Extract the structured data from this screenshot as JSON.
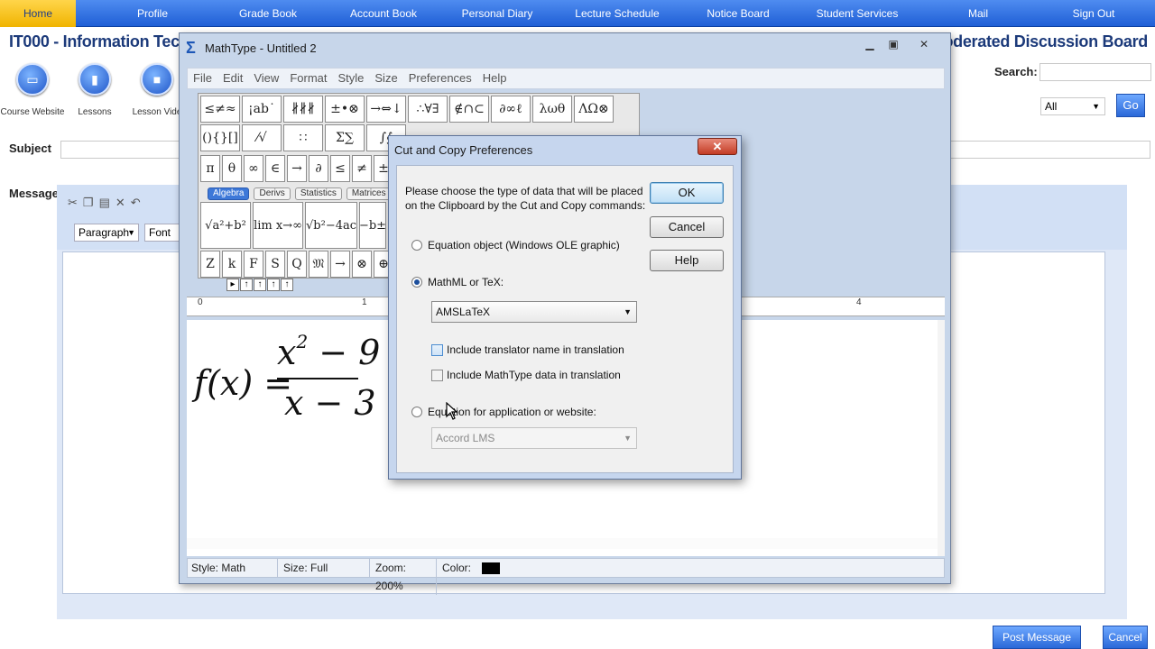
{
  "topnav": {
    "items": [
      "Home",
      "Profile",
      "Grade Book",
      "Account Book",
      "Personal Diary",
      "Lecture Schedule",
      "Notice Board",
      "Student Services",
      "Mail",
      "Sign Out"
    ]
  },
  "course": {
    "title": "IT000 - Information Techno",
    "board_title": "Moderated Discussion Board"
  },
  "search": {
    "label": "Search:",
    "value": ""
  },
  "filter": {
    "selected": "All",
    "go_label": "Go"
  },
  "quick_links": [
    {
      "label": "Course Website",
      "icon": "monitor-icon"
    },
    {
      "label": "Lessons",
      "icon": "book-icon"
    },
    {
      "label": "Lesson Vide",
      "icon": "video-camera-icon"
    }
  ],
  "form": {
    "subject_label": "Subject",
    "message_label": "Message",
    "paragraph_label": "Paragraph",
    "font_label": "Font",
    "post_label": "Post Message",
    "cancel_label": "Cancel"
  },
  "mathtype": {
    "title": "MathType - Untitled 2",
    "menu": [
      "File",
      "Edit",
      "View",
      "Format",
      "Style",
      "Size",
      "Preferences",
      "Help"
    ],
    "symbol_row1": [
      "≤≠≈",
      "¡ab˙",
      "∦∦∦",
      "±•⊗",
      "→⇔↓",
      "∴∀∃",
      "∉∩⊂",
      "∂∞ℓ",
      "λωθ",
      "ΛΩ⊗"
    ],
    "symbol_row2": [
      "(){}[]",
      "⁄√",
      "∷",
      "Σ∑",
      "∫∮",
      "⇌",
      "→",
      "∷",
      "∷",
      "∷"
    ],
    "symbol_row3": [
      "π",
      "θ",
      "∞",
      "∈",
      "→",
      "∂",
      "≤",
      "≠",
      "±"
    ],
    "tabs": [
      "Algebra",
      "Derivs",
      "Statistics",
      "Matrices"
    ],
    "active_tab": "Algebra",
    "templates": [
      "√a²+b²",
      "lim x→∞",
      "√b²−4ac",
      "−b±"
    ],
    "symbol_row4": [
      "Z",
      "k",
      "F",
      "S",
      "Q",
      "𝔐",
      "→",
      "⊗",
      "⊕"
    ],
    "ruler_labels": [
      "0",
      "1",
      "4"
    ],
    "equation": {
      "lhs": "f(x) =",
      "numerator_base": "x",
      "numerator_exp": "2",
      "numerator_rest": " − 9",
      "denominator": "x − 3"
    },
    "status": {
      "style": "Style: Math",
      "size": "Size: Full",
      "zoom": "Zoom: 200%",
      "color_label": "Color:",
      "color_value": "#000000"
    }
  },
  "dialog": {
    "title": "Cut and Copy Preferences",
    "close_label": "✕",
    "description": "Please choose the type of data that will be placed on the Clipboard by the Cut and Copy commands:",
    "ok_label": "OK",
    "cancel_label": "Cancel",
    "help_label": "Help",
    "option_equation_object": "Equation object (Windows OLE graphic)",
    "option_mathml": "MathML or TeX:",
    "mathml_format": "AMSLaTeX",
    "check_translator_name": "Include translator name in translation",
    "check_mathtype_data": "Include MathType data in translation",
    "option_app_website": "Equation for application or website:",
    "app_target": "Accord LMS",
    "selected_option": "MathML or TeX:"
  }
}
